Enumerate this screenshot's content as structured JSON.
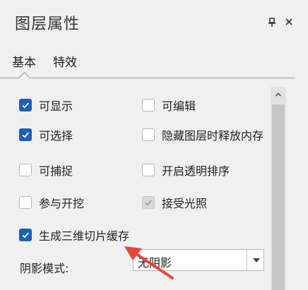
{
  "panel": {
    "title": "图层属性",
    "pin_icon": "pin-icon",
    "close_icon": "close-icon"
  },
  "tabs": [
    {
      "label": "基本",
      "active": true
    },
    {
      "label": "特效",
      "active": false
    }
  ],
  "options": [
    {
      "label": "可显示",
      "checked": true,
      "enabled": true
    },
    {
      "label": "可编辑",
      "checked": false,
      "enabled": true
    },
    {
      "label": "可选择",
      "checked": true,
      "enabled": true
    },
    {
      "label": "隐藏图层时释放内存",
      "checked": false,
      "enabled": true
    },
    {
      "label": "可捕捉",
      "checked": false,
      "enabled": true
    },
    {
      "label": "开启透明排序",
      "checked": false,
      "enabled": true
    },
    {
      "label": "参与开挖",
      "checked": false,
      "enabled": true
    },
    {
      "label": "接受光照",
      "checked": true,
      "enabled": false
    },
    {
      "label": "生成三维切片缓存",
      "checked": true,
      "enabled": true
    }
  ],
  "shadow_mode": {
    "label": "阴影模式:",
    "value": "无阴影"
  },
  "colors": {
    "accent": "#1d5fb6",
    "annotation_arrow": "#e8453c",
    "panel_bg": "#f0f0f0"
  },
  "scrollbar": {
    "up_icon": "chevron-up-icon"
  }
}
